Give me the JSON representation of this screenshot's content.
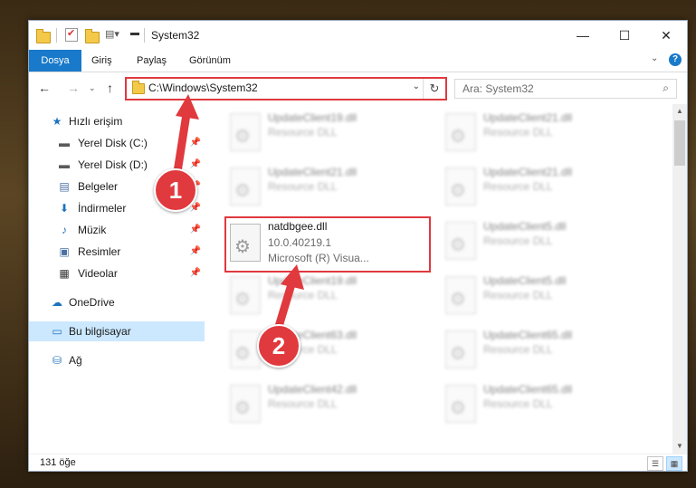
{
  "window": {
    "title": "System32",
    "controls": {
      "minimize": "—",
      "maximize": "☐",
      "close": "✕"
    }
  },
  "ribbon": {
    "tabs": [
      {
        "label": "Dosya",
        "active": true
      },
      {
        "label": "Giriş"
      },
      {
        "label": "Paylaş"
      },
      {
        "label": "Görünüm"
      }
    ],
    "help": "?"
  },
  "navigation": {
    "address": "C:\\Windows\\System32",
    "search_placeholder": "Ara: System32"
  },
  "sidebar": {
    "items": [
      {
        "label": "Hızlı erişim",
        "icon": "star-icon",
        "glyph": "★",
        "color": "#1e73be"
      },
      {
        "label": "Yerel Disk (C:)",
        "icon": "drive-icon",
        "glyph": "▬",
        "color": "#5a5a5a",
        "pinned": true
      },
      {
        "label": "Yerel Disk (D:)",
        "icon": "drive-icon",
        "glyph": "▬",
        "color": "#5a5a5a",
        "pinned": true
      },
      {
        "label": "Belgeler",
        "icon": "documents-icon",
        "glyph": "▤",
        "color": "#4a6fa5",
        "pinned": true
      },
      {
        "label": "İndirmeler",
        "icon": "download-icon",
        "glyph": "⬇",
        "color": "#1e73be",
        "pinned": true
      },
      {
        "label": "Müzik",
        "icon": "music-icon",
        "glyph": "♪",
        "color": "#1e73be",
        "pinned": true
      },
      {
        "label": "Resimler",
        "icon": "pictures-icon",
        "glyph": "▣",
        "color": "#4a6fa5",
        "pinned": true
      },
      {
        "label": "Videolar",
        "icon": "video-icon",
        "glyph": "▦",
        "color": "#333",
        "pinned": true
      },
      {
        "label": "OneDrive",
        "icon": "cloud-icon",
        "glyph": "☁",
        "color": "#1e73be"
      },
      {
        "label": "Bu bilgisayar",
        "icon": "computer-icon",
        "glyph": "▭",
        "color": "#1e73be",
        "selected": true
      },
      {
        "label": "Ağ",
        "icon": "network-icon",
        "glyph": "⛁",
        "color": "#1e73be"
      }
    ]
  },
  "files": [
    {
      "name": "UpdateClient19.dll",
      "desc": "Resource DLL"
    },
    {
      "name": "UpdateClient21.dll",
      "desc": "Resource DLL"
    },
    {
      "name": "UpdateClient21.dll",
      "desc": "Resource DLL"
    },
    {
      "name": "UpdateClient21.dll",
      "desc": "Resource DLL"
    },
    {
      "name": "natdbgee.dll",
      "version": "10.0.40219.1",
      "company": "Microsoft (R) Visua...",
      "highlighted": true
    },
    {
      "name": "UpdateClient5.dll",
      "desc": "Resource DLL"
    },
    {
      "name": "UpdateClient19.dll",
      "desc": "Resource DLL"
    },
    {
      "name": "UpdateClient5.dll",
      "desc": "Resource DLL"
    },
    {
      "name": "UpdateClient63.dll",
      "desc": "Resource DLL"
    },
    {
      "name": "UpdateClient65.dll",
      "desc": "Resource DLL"
    },
    {
      "name": "UpdateClient42.dll",
      "desc": "Resource DLL"
    },
    {
      "name": "UpdateClient65.dll",
      "desc": "Resource DLL"
    }
  ],
  "status": {
    "item_count": "131 öğe"
  },
  "annotations": {
    "step1": "1",
    "step2": "2",
    "accent": "#e0393e"
  }
}
